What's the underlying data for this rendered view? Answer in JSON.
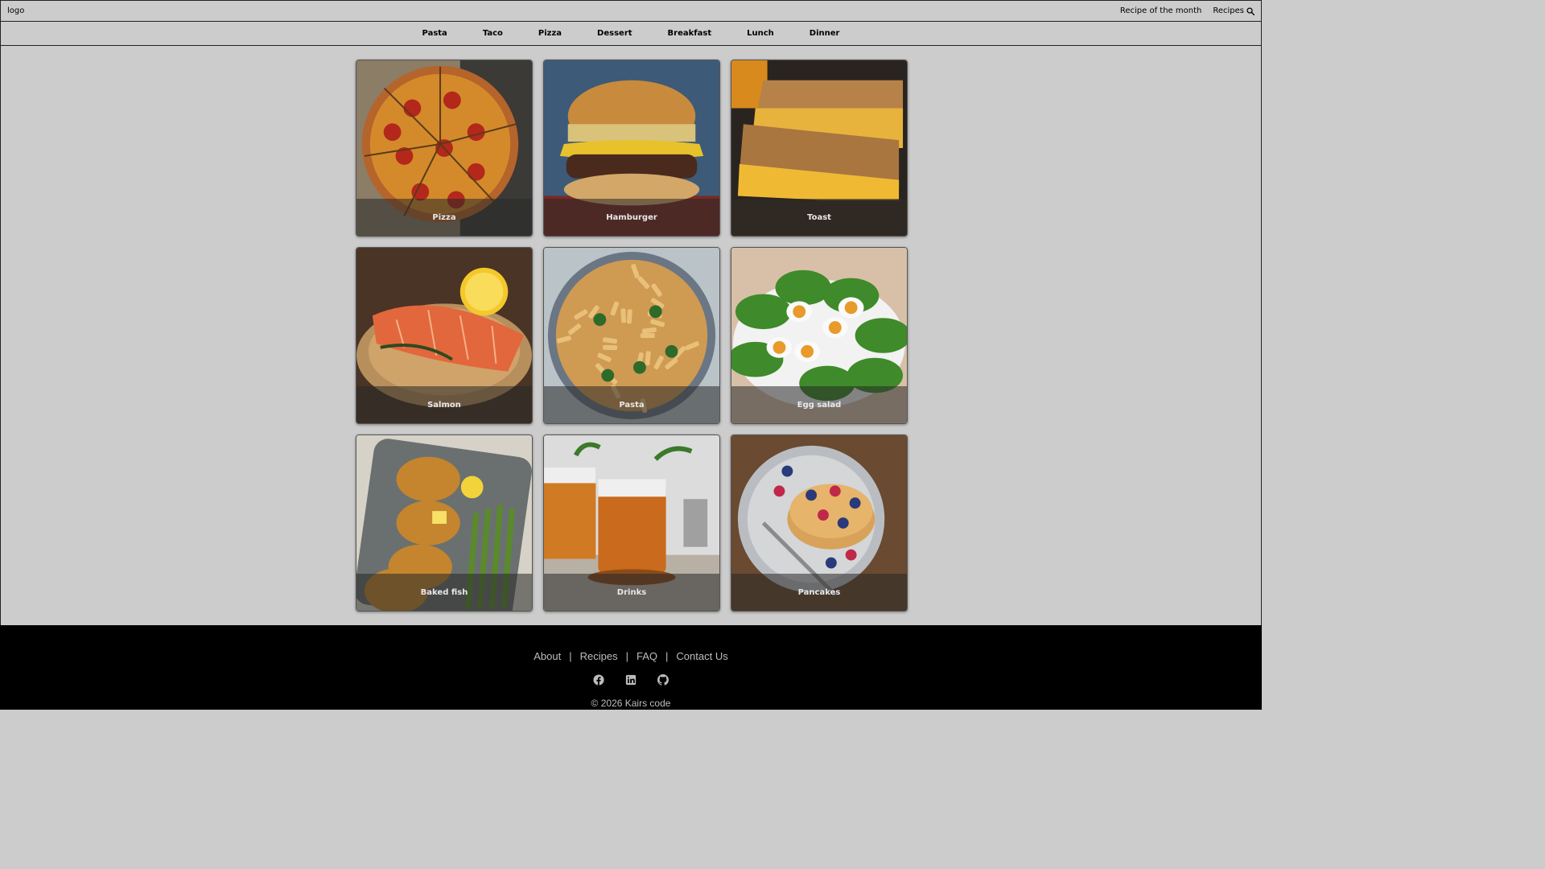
{
  "header": {
    "logo_label": "logo",
    "nav_recipe_of_month": "Recipe of the month",
    "nav_recipes": "Recipes",
    "search_icon": "search-icon"
  },
  "categories": [
    "Pasta",
    "Taco",
    "Pizza",
    "Dessert",
    "Breakfast",
    "Lunch",
    "Dinner"
  ],
  "cards": [
    {
      "label": "Pizza",
      "image": "pizza-image"
    },
    {
      "label": "Hamburger",
      "image": "hamburger-image"
    },
    {
      "label": "Toast",
      "image": "toast-image"
    },
    {
      "label": "Salmon",
      "image": "salmon-image"
    },
    {
      "label": "Pasta",
      "image": "pasta-image"
    },
    {
      "label": "Egg salad",
      "image": "egg-salad-image"
    },
    {
      "label": "Baked fish",
      "image": "baked-fish-image"
    },
    {
      "label": "Drinks",
      "image": "drinks-image"
    },
    {
      "label": "Pancakes",
      "image": "pancakes-image"
    }
  ],
  "footer": {
    "links": [
      "About",
      "Recipes",
      "FAQ",
      "Contact Us"
    ],
    "separator": "|",
    "social_icons": [
      "facebook-icon",
      "linkedin-icon",
      "github-icon"
    ],
    "copyright": "© 2026 Kairs code"
  },
  "colors": {
    "page_bg": "#cccccc",
    "footer_bg": "#000000",
    "footer_text": "#bdbdbd",
    "caption_text": "#e8e8e8"
  }
}
